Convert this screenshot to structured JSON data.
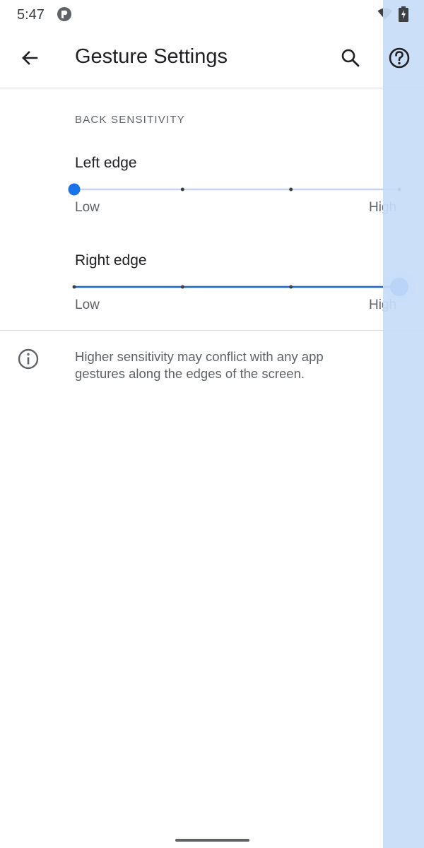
{
  "status_bar": {
    "time": "5:47",
    "icons": [
      "app-notification-icon",
      "wifi-icon",
      "battery-charging-icon"
    ]
  },
  "app_bar": {
    "title": "Gesture Settings",
    "back_icon": "arrow-back-icon",
    "search_icon": "search-icon",
    "help_icon": "help-icon"
  },
  "section": {
    "header": "BACK SENSITIVITY"
  },
  "sliders": [
    {
      "title": "Left edge",
      "min_label": "Low",
      "max_label": "High",
      "steps": 4,
      "value_index": 0,
      "active": false
    },
    {
      "title": "Right edge",
      "min_label": "Low",
      "max_label": "High",
      "steps": 4,
      "value_index": 3,
      "active": true
    }
  ],
  "info": {
    "icon": "info-icon",
    "text": "Higher sensitivity may conflict with any app gestures along the edges of the screen."
  },
  "colors": {
    "accent": "#1a73e8",
    "track_inactive": "#c6d5ee",
    "track_active": "#1967d2",
    "tick": "#3c4043",
    "edge_overlay": "#c8dcf8",
    "text_primary": "#202124",
    "text_secondary": "#5f6368"
  }
}
